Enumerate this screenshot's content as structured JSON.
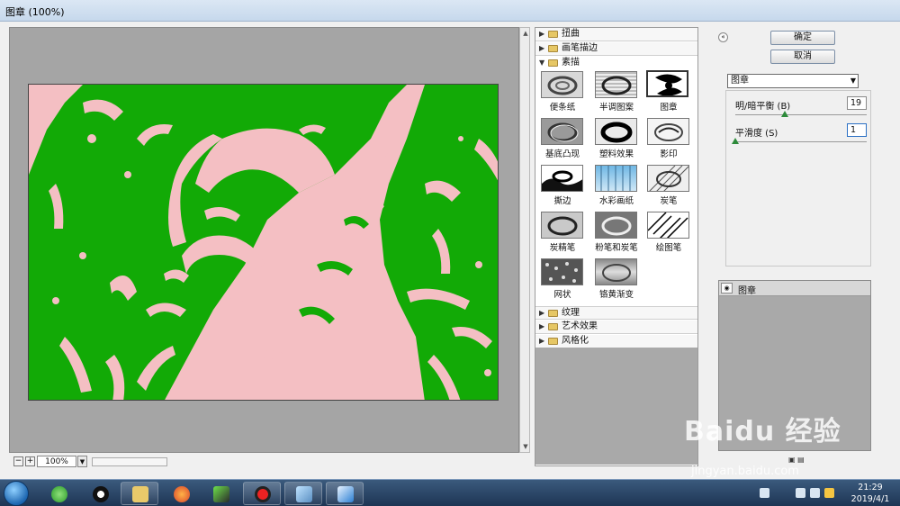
{
  "window": {
    "title": "图章 (100%)"
  },
  "preview": {
    "zoom": "100%",
    "zoom_out": "−",
    "zoom_in": "+",
    "image_colors": {
      "background": "#12aa06",
      "foreground": "#f4bfc3"
    }
  },
  "gallery": {
    "categories_top": [
      {
        "label": "扭曲",
        "expanded": false
      },
      {
        "label": "画笔描边",
        "expanded": false
      },
      {
        "label": "素描",
        "expanded": true
      }
    ],
    "filters": [
      {
        "label": "便条纸"
      },
      {
        "label": "半调图案"
      },
      {
        "label": "图章",
        "selected": true
      },
      {
        "label": "基底凸现"
      },
      {
        "label": "塑料效果"
      },
      {
        "label": "影印"
      },
      {
        "label": "撕边"
      },
      {
        "label": "水彩画纸"
      },
      {
        "label": "炭笔"
      },
      {
        "label": "炭精笔"
      },
      {
        "label": "粉笔和炭笔"
      },
      {
        "label": "绘图笔"
      },
      {
        "label": "网状"
      },
      {
        "label": "铬黄渐变"
      }
    ],
    "categories_bottom": [
      {
        "label": "纹理",
        "expanded": false
      },
      {
        "label": "艺术效果",
        "expanded": false
      },
      {
        "label": "风格化",
        "expanded": false
      }
    ]
  },
  "panel": {
    "ok_label": "确定",
    "cancel_label": "取消",
    "filter_select": "图章",
    "params": [
      {
        "label": "明/暗平衡 (B)",
        "value": "19",
        "position": 0.38
      },
      {
        "label": "平滑度 (S)",
        "value": "1",
        "position": 0.0
      }
    ],
    "layer_name": "图章"
  },
  "taskbar": {
    "time": "21:29",
    "date": "2019/4/1"
  },
  "watermark": {
    "brand": "Baidu 经验",
    "url": "jingyan.baidu.com"
  }
}
